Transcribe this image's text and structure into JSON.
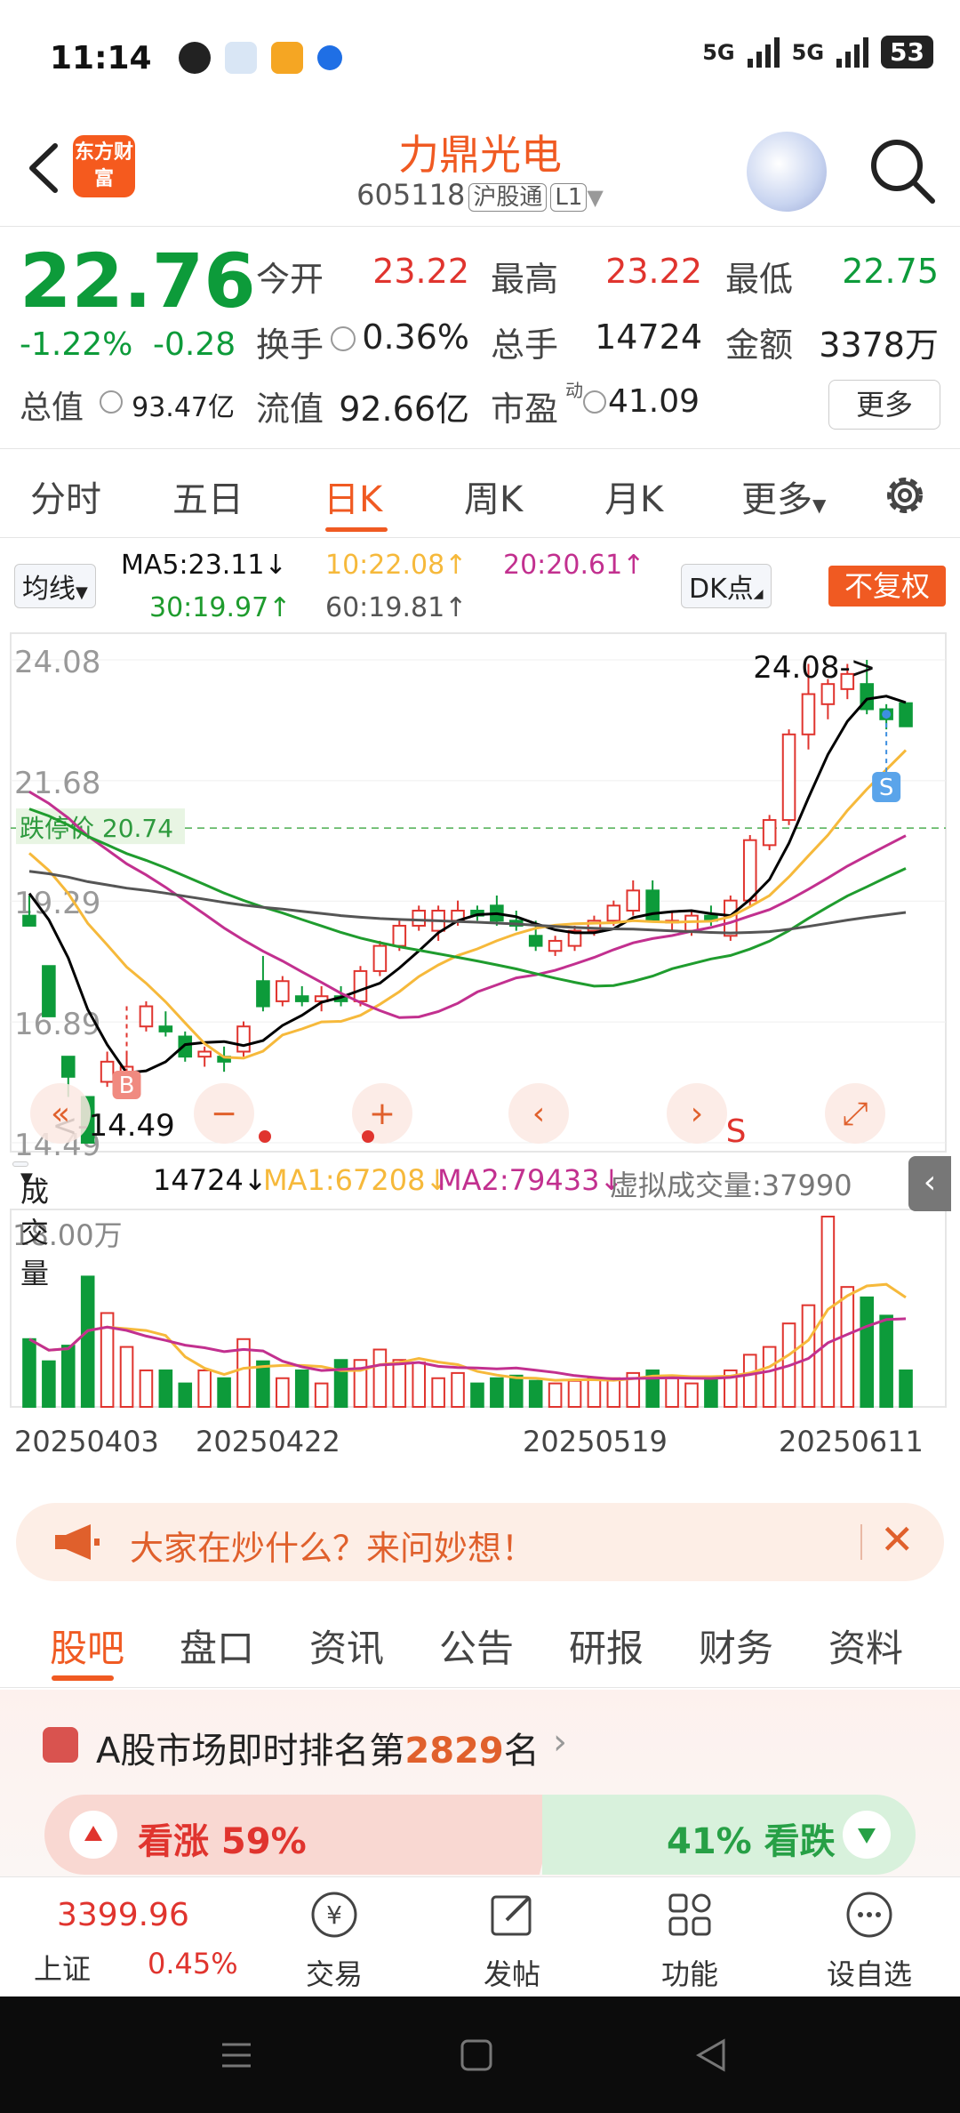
{
  "status_bar": {
    "time": "11:14",
    "battery": "53",
    "network": "5G"
  },
  "header": {
    "logo_text": "东方财富",
    "stock_name": "力鼎光电",
    "stock_code": "605118",
    "market_tag": "沪股通",
    "level_tag": "L1"
  },
  "quote": {
    "price": "22.76",
    "change_pct": "-1.22%",
    "change": "-0.28",
    "open_label": "今开",
    "open": "23.22",
    "high_label": "最高",
    "high": "23.22",
    "low_label": "最低",
    "low": "22.75",
    "turnover_label": "换手",
    "turnover": "0.36%",
    "volume_label": "总手",
    "volume": "14724",
    "amount_label": "金额",
    "amount": "3378万",
    "mktcap_label": "总值",
    "mktcap": "93.47亿",
    "float_label": "流值",
    "float_cap": "92.66亿",
    "pe_label": "市盈",
    "pe_sup": "动",
    "pe": "41.09",
    "more_button": "更多"
  },
  "period_tabs": [
    "分时",
    "五日",
    "日K",
    "周K",
    "月K",
    "更多"
  ],
  "active_period": "日K",
  "ma_legend": {
    "toggle": "均线",
    "ma5": "MA5:23.11↓",
    "ma10": "10:22.08↑",
    "ma20": "20:20.61↑",
    "ma30": "30:19.97↑",
    "ma60": "60:19.81↑",
    "dk_button": "DK点",
    "adjust_button": "不复权"
  },
  "chart_labels": {
    "y_ticks": [
      "24.08",
      "21.68",
      "19.29",
      "16.89",
      "14.49"
    ],
    "limit_down": "跌停价 20.74",
    "high_marker": "24.08->",
    "low_marker": "<-14.49",
    "buy_marker": "B",
    "sell_marker": "S",
    "sell_marker_2": "S"
  },
  "volume_header": {
    "selector": "成交量",
    "vol": "14724↓",
    "ma1": "MA1:67208↓",
    "ma2": "MA2:79433↓",
    "virtual": "虚拟成交量:37990",
    "y_label": "18.00万"
  },
  "date_labels": [
    "20250403",
    "20250422",
    "20250519",
    "20250611"
  ],
  "colors": {
    "up": "#e0342e",
    "down": "#0d9b3a",
    "accent": "#f05a22",
    "ma5": "#000000",
    "ma10": "#f6b93b",
    "ma20": "#c2308f",
    "ma30": "#1f9c2e",
    "ma60": "#555555"
  },
  "chart_data": {
    "type": "candlestick",
    "x_range": [
      "20250403",
      "20250611"
    ],
    "ylim": [
      14.49,
      24.08
    ],
    "candles": [
      {
        "o": 19.0,
        "h": 19.4,
        "l": 18.9,
        "c": 18.8
      },
      {
        "o": 18.0,
        "h": 18.0,
        "l": 17.0,
        "c": 17.0
      },
      {
        "o": 16.2,
        "h": 16.2,
        "l": 15.4,
        "c": 15.8
      },
      {
        "o": 15.4,
        "h": 15.2,
        "l": 14.6,
        "c": 14.49
      },
      {
        "o": 15.7,
        "h": 16.3,
        "l": 15.6,
        "c": 16.1
      },
      {
        "o": 15.8,
        "h": 16.3,
        "l": 15.6,
        "c": 16.0
      },
      {
        "o": 16.8,
        "h": 17.3,
        "l": 16.7,
        "c": 17.2
      },
      {
        "o": 16.8,
        "h": 17.1,
        "l": 16.6,
        "c": 16.7
      },
      {
        "o": 16.6,
        "h": 16.7,
        "l": 16.1,
        "c": 16.2
      },
      {
        "o": 16.2,
        "h": 16.4,
        "l": 16.0,
        "c": 16.3
      },
      {
        "o": 16.2,
        "h": 16.4,
        "l": 15.9,
        "c": 16.1
      },
      {
        "o": 16.3,
        "h": 16.9,
        "l": 16.2,
        "c": 16.8
      },
      {
        "o": 17.7,
        "h": 18.2,
        "l": 17.1,
        "c": 17.2
      },
      {
        "o": 17.3,
        "h": 17.8,
        "l": 17.2,
        "c": 17.7
      },
      {
        "o": 17.4,
        "h": 17.6,
        "l": 17.2,
        "c": 17.3
      },
      {
        "o": 17.3,
        "h": 17.6,
        "l": 17.1,
        "c": 17.4
      },
      {
        "o": 17.4,
        "h": 17.6,
        "l": 17.2,
        "c": 17.3
      },
      {
        "o": 17.3,
        "h": 18.0,
        "l": 17.2,
        "c": 17.9
      },
      {
        "o": 17.9,
        "h": 18.5,
        "l": 17.8,
        "c": 18.4
      },
      {
        "o": 18.4,
        "h": 18.9,
        "l": 18.3,
        "c": 18.8
      },
      {
        "o": 18.8,
        "h": 19.2,
        "l": 18.7,
        "c": 19.1
      },
      {
        "o": 18.7,
        "h": 19.2,
        "l": 18.5,
        "c": 19.1
      },
      {
        "o": 18.9,
        "h": 19.3,
        "l": 18.8,
        "c": 19.1
      },
      {
        "o": 19.1,
        "h": 19.2,
        "l": 18.9,
        "c": 19.0
      },
      {
        "o": 19.2,
        "h": 19.4,
        "l": 18.8,
        "c": 18.9
      },
      {
        "o": 18.9,
        "h": 19.1,
        "l": 18.7,
        "c": 18.8
      },
      {
        "o": 18.6,
        "h": 18.9,
        "l": 18.3,
        "c": 18.4
      },
      {
        "o": 18.3,
        "h": 18.6,
        "l": 18.2,
        "c": 18.5
      },
      {
        "o": 18.4,
        "h": 18.8,
        "l": 18.3,
        "c": 18.7
      },
      {
        "o": 18.7,
        "h": 19.0,
        "l": 18.6,
        "c": 18.9
      },
      {
        "o": 18.9,
        "h": 19.3,
        "l": 18.8,
        "c": 19.2
      },
      {
        "o": 19.1,
        "h": 19.7,
        "l": 19.0,
        "c": 19.5
      },
      {
        "o": 19.5,
        "h": 19.7,
        "l": 18.9,
        "c": 18.9
      },
      {
        "o": 18.9,
        "h": 19.1,
        "l": 18.7,
        "c": 18.9
      },
      {
        "o": 18.7,
        "h": 19.1,
        "l": 18.6,
        "c": 19.0
      },
      {
        "o": 19.0,
        "h": 19.2,
        "l": 18.8,
        "c": 18.9
      },
      {
        "o": 18.6,
        "h": 19.4,
        "l": 18.5,
        "c": 19.3
      },
      {
        "o": 19.3,
        "h": 20.6,
        "l": 19.2,
        "c": 20.5
      },
      {
        "o": 20.4,
        "h": 21.0,
        "l": 20.3,
        "c": 20.9
      },
      {
        "o": 20.9,
        "h": 22.7,
        "l": 20.8,
        "c": 22.6
      },
      {
        "o": 22.6,
        "h": 24.0,
        "l": 22.3,
        "c": 23.4
      },
      {
        "o": 23.2,
        "h": 23.7,
        "l": 22.9,
        "c": 23.6
      },
      {
        "o": 23.5,
        "h": 24.0,
        "l": 23.3,
        "c": 23.8
      },
      {
        "o": 23.6,
        "h": 24.08,
        "l": 23.0,
        "c": 23.1
      },
      {
        "o": 23.1,
        "h": 23.2,
        "l": 22.7,
        "c": 22.9
      },
      {
        "o": 23.22,
        "h": 23.22,
        "l": 22.75,
        "c": 22.76
      }
    ],
    "volume": [
      52,
      35,
      47,
      100,
      72,
      46,
      28,
      28,
      18,
      28,
      22,
      52,
      35,
      22,
      28,
      18,
      36,
      36,
      44,
      36,
      34,
      22,
      26,
      18,
      22,
      24,
      20,
      18,
      20,
      22,
      22,
      26,
      28,
      22,
      18,
      22,
      28,
      40,
      46,
      64,
      78,
      146,
      92,
      84,
      70,
      28
    ],
    "title": "",
    "xlabel": "",
    "ylabel": ""
  },
  "ask_banner": {
    "text": "大家在炒什么？来问妙想！"
  },
  "guba_tabs": [
    "股吧",
    "盘口",
    "资讯",
    "公告",
    "研报",
    "财务",
    "资料"
  ],
  "active_guba_tab": "股吧",
  "rank": {
    "prefix": "A股市场即时排名第",
    "number": "2829",
    "suffix": "名",
    "up_label": "看涨 59%",
    "down_label": "41% 看跌"
  },
  "bottom_nav": {
    "index_value": "3399.96",
    "index_name": "上证",
    "index_change": "0.45%",
    "items": [
      "交易",
      "发帖",
      "功能",
      "设自选"
    ]
  }
}
